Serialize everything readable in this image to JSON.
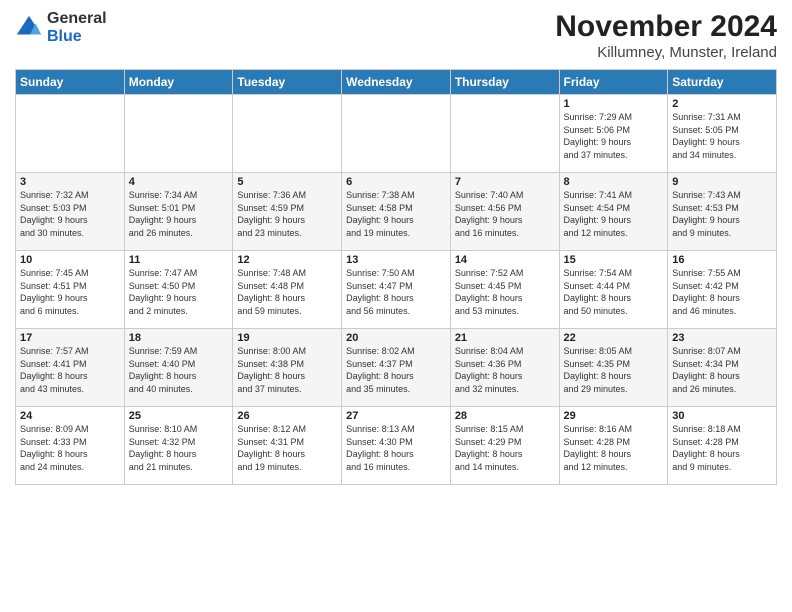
{
  "logo": {
    "general": "General",
    "blue": "Blue"
  },
  "title": "November 2024",
  "subtitle": "Killumney, Munster, Ireland",
  "headers": [
    "Sunday",
    "Monday",
    "Tuesday",
    "Wednesday",
    "Thursday",
    "Friday",
    "Saturday"
  ],
  "weeks": [
    [
      {
        "day": "",
        "info": ""
      },
      {
        "day": "",
        "info": ""
      },
      {
        "day": "",
        "info": ""
      },
      {
        "day": "",
        "info": ""
      },
      {
        "day": "",
        "info": ""
      },
      {
        "day": "1",
        "info": "Sunrise: 7:29 AM\nSunset: 5:06 PM\nDaylight: 9 hours\nand 37 minutes."
      },
      {
        "day": "2",
        "info": "Sunrise: 7:31 AM\nSunset: 5:05 PM\nDaylight: 9 hours\nand 34 minutes."
      }
    ],
    [
      {
        "day": "3",
        "info": "Sunrise: 7:32 AM\nSunset: 5:03 PM\nDaylight: 9 hours\nand 30 minutes."
      },
      {
        "day": "4",
        "info": "Sunrise: 7:34 AM\nSunset: 5:01 PM\nDaylight: 9 hours\nand 26 minutes."
      },
      {
        "day": "5",
        "info": "Sunrise: 7:36 AM\nSunset: 4:59 PM\nDaylight: 9 hours\nand 23 minutes."
      },
      {
        "day": "6",
        "info": "Sunrise: 7:38 AM\nSunset: 4:58 PM\nDaylight: 9 hours\nand 19 minutes."
      },
      {
        "day": "7",
        "info": "Sunrise: 7:40 AM\nSunset: 4:56 PM\nDaylight: 9 hours\nand 16 minutes."
      },
      {
        "day": "8",
        "info": "Sunrise: 7:41 AM\nSunset: 4:54 PM\nDaylight: 9 hours\nand 12 minutes."
      },
      {
        "day": "9",
        "info": "Sunrise: 7:43 AM\nSunset: 4:53 PM\nDaylight: 9 hours\nand 9 minutes."
      }
    ],
    [
      {
        "day": "10",
        "info": "Sunrise: 7:45 AM\nSunset: 4:51 PM\nDaylight: 9 hours\nand 6 minutes."
      },
      {
        "day": "11",
        "info": "Sunrise: 7:47 AM\nSunset: 4:50 PM\nDaylight: 9 hours\nand 2 minutes."
      },
      {
        "day": "12",
        "info": "Sunrise: 7:48 AM\nSunset: 4:48 PM\nDaylight: 8 hours\nand 59 minutes."
      },
      {
        "day": "13",
        "info": "Sunrise: 7:50 AM\nSunset: 4:47 PM\nDaylight: 8 hours\nand 56 minutes."
      },
      {
        "day": "14",
        "info": "Sunrise: 7:52 AM\nSunset: 4:45 PM\nDaylight: 8 hours\nand 53 minutes."
      },
      {
        "day": "15",
        "info": "Sunrise: 7:54 AM\nSunset: 4:44 PM\nDaylight: 8 hours\nand 50 minutes."
      },
      {
        "day": "16",
        "info": "Sunrise: 7:55 AM\nSunset: 4:42 PM\nDaylight: 8 hours\nand 46 minutes."
      }
    ],
    [
      {
        "day": "17",
        "info": "Sunrise: 7:57 AM\nSunset: 4:41 PM\nDaylight: 8 hours\nand 43 minutes."
      },
      {
        "day": "18",
        "info": "Sunrise: 7:59 AM\nSunset: 4:40 PM\nDaylight: 8 hours\nand 40 minutes."
      },
      {
        "day": "19",
        "info": "Sunrise: 8:00 AM\nSunset: 4:38 PM\nDaylight: 8 hours\nand 37 minutes."
      },
      {
        "day": "20",
        "info": "Sunrise: 8:02 AM\nSunset: 4:37 PM\nDaylight: 8 hours\nand 35 minutes."
      },
      {
        "day": "21",
        "info": "Sunrise: 8:04 AM\nSunset: 4:36 PM\nDaylight: 8 hours\nand 32 minutes."
      },
      {
        "day": "22",
        "info": "Sunrise: 8:05 AM\nSunset: 4:35 PM\nDaylight: 8 hours\nand 29 minutes."
      },
      {
        "day": "23",
        "info": "Sunrise: 8:07 AM\nSunset: 4:34 PM\nDaylight: 8 hours\nand 26 minutes."
      }
    ],
    [
      {
        "day": "24",
        "info": "Sunrise: 8:09 AM\nSunset: 4:33 PM\nDaylight: 8 hours\nand 24 minutes."
      },
      {
        "day": "25",
        "info": "Sunrise: 8:10 AM\nSunset: 4:32 PM\nDaylight: 8 hours\nand 21 minutes."
      },
      {
        "day": "26",
        "info": "Sunrise: 8:12 AM\nSunset: 4:31 PM\nDaylight: 8 hours\nand 19 minutes."
      },
      {
        "day": "27",
        "info": "Sunrise: 8:13 AM\nSunset: 4:30 PM\nDaylight: 8 hours\nand 16 minutes."
      },
      {
        "day": "28",
        "info": "Sunrise: 8:15 AM\nSunset: 4:29 PM\nDaylight: 8 hours\nand 14 minutes."
      },
      {
        "day": "29",
        "info": "Sunrise: 8:16 AM\nSunset: 4:28 PM\nDaylight: 8 hours\nand 12 minutes."
      },
      {
        "day": "30",
        "info": "Sunrise: 8:18 AM\nSunset: 4:28 PM\nDaylight: 8 hours\nand 9 minutes."
      }
    ]
  ]
}
